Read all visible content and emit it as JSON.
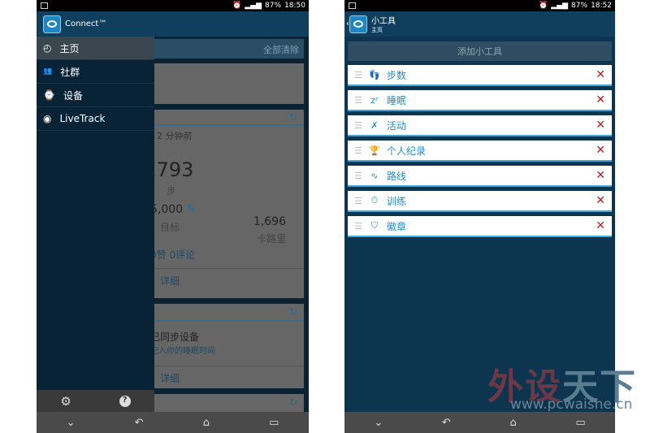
{
  "left": {
    "status_time": "18:50",
    "battery": "87%",
    "app_title": "Connect™",
    "drawer": {
      "items": [
        {
          "icon": "dashboard-icon",
          "label": "主页"
        },
        {
          "icon": "people-icon",
          "label": "社群"
        },
        {
          "icon": "watch-icon",
          "label": "设备"
        },
        {
          "icon": "eye-icon",
          "label": "LiveTrack"
        }
      ],
      "footer": {
        "settings_icon": "gear-icon",
        "help_icon": "help-icon"
      }
    },
    "content": {
      "clear_all": "全部清除",
      "time_ago": "2 分钟前",
      "steps": ",793",
      "steps_unit": "步",
      "goal": "5,000",
      "goal_label": "目标",
      "calories": "1,696",
      "calories_label": "卡路里",
      "social": "0赞 0评论",
      "details": "详细",
      "sync_title": "已同步设备",
      "sync_sub": "记入你的睡眠时间",
      "details2": "详细"
    }
  },
  "right": {
    "status_time": "18:52",
    "battery": "87%",
    "title": "小工具",
    "subtitle": "主页",
    "add_button": "添加小工具",
    "widgets": [
      {
        "icon": "footprints-icon",
        "label": "步数"
      },
      {
        "icon": "sleep-icon",
        "label": "睡眠"
      },
      {
        "icon": "activity-icon",
        "label": "活动"
      },
      {
        "icon": "trophy-icon",
        "label": "个人纪录"
      },
      {
        "icon": "route-icon",
        "label": "路线"
      },
      {
        "icon": "stopwatch-icon",
        "label": "训练"
      },
      {
        "icon": "badge-icon",
        "label": "徽章"
      }
    ]
  },
  "watermark": {
    "text1": "外设",
    "text2": "天下",
    "url": "www.pcwaishe.cn"
  }
}
